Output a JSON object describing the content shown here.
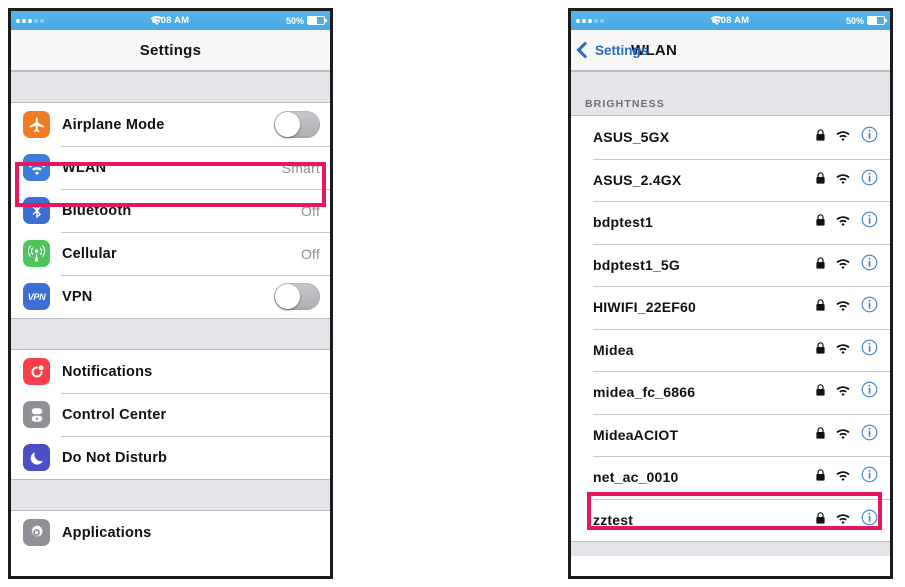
{
  "left_phone": {
    "status_bar": {
      "carrier": "",
      "time": "8:08 AM",
      "battery_percent": "50%",
      "wifi_icon": "wifi-icon",
      "battery_icon": "battery-icon",
      "signal_dots_filled": 3,
      "signal_dots_empty": 2
    },
    "nav": {
      "title": "Settings"
    },
    "groups": [
      {
        "rows": [
          {
            "label": "Airplane Mode",
            "icon": "airplane-icon",
            "icon_color": "#f07c25",
            "control": "toggle",
            "toggle_on": false
          },
          {
            "label": "WLAN",
            "icon": "wifi-icon",
            "icon_color": "#3b7ddd",
            "control": "value",
            "value": "Smart",
            "highlighted": true
          },
          {
            "label": "Bluetooth",
            "icon": "bluetooth-icon",
            "icon_color": "#3b6fd4",
            "control": "value",
            "value": "Off"
          },
          {
            "label": "Cellular",
            "icon": "cellular-icon",
            "icon_color": "#4cc65b",
            "control": "value",
            "value": "Off"
          },
          {
            "label": "VPN",
            "icon": "vpn-icon",
            "icon_color": "#3b6fd4",
            "control": "toggle",
            "toggle_on": false
          }
        ]
      },
      {
        "rows": [
          {
            "label": "Notifications",
            "icon": "notifications-icon",
            "icon_color": "#f8404a",
            "control": "none"
          },
          {
            "label": "Control Center",
            "icon": "control-center-icon",
            "icon_color": "#8e9096",
            "control": "none"
          },
          {
            "label": "Do Not Disturb",
            "icon": "moon-icon",
            "icon_color": "#4a4fc4",
            "control": "none"
          }
        ]
      },
      {
        "rows": [
          {
            "label": "Applications",
            "icon": "gear-icon",
            "icon_color": "#8e9096",
            "control": "none"
          }
        ]
      }
    ]
  },
  "right_phone": {
    "status_bar": {
      "time": "8:08 AM",
      "battery_percent": "50%",
      "wifi_icon": "wifi-icon",
      "battery_icon": "battery-icon",
      "signal_dots_filled": 3,
      "signal_dots_empty": 2
    },
    "nav": {
      "back_label": "Settings",
      "back_icon": "chevron-left-icon",
      "title": "WLAN"
    },
    "section_header": "BRIGHTNESS",
    "networks": [
      {
        "ssid": "ASUS_5GX",
        "secured": true,
        "signal": 3,
        "highlighted": false
      },
      {
        "ssid": "ASUS_2.4GX",
        "secured": true,
        "signal": 3,
        "highlighted": false
      },
      {
        "ssid": "bdptest1",
        "secured": true,
        "signal": 3,
        "highlighted": false
      },
      {
        "ssid": "bdptest1_5G",
        "secured": true,
        "signal": 3,
        "highlighted": false
      },
      {
        "ssid": "HIWIFI_22EF60",
        "secured": true,
        "signal": 3,
        "highlighted": false
      },
      {
        "ssid": "Midea",
        "secured": true,
        "signal": 3,
        "highlighted": false
      },
      {
        "ssid": "midea_fc_6866",
        "secured": true,
        "signal": 3,
        "highlighted": false
      },
      {
        "ssid": "MideaACIOT",
        "secured": true,
        "signal": 3,
        "highlighted": false
      },
      {
        "ssid": "net_ac_0010",
        "secured": true,
        "signal": 3,
        "highlighted": true
      },
      {
        "ssid": "zztest",
        "secured": true,
        "signal": 3,
        "highlighted": false
      }
    ],
    "row_icons": {
      "lock": "lock-icon",
      "wifi": "wifi-icon",
      "info": "info-icon"
    }
  },
  "colors": {
    "highlight": "#e8175d",
    "status_bar": "#50b0e8",
    "accent_blue": "#2b6cb8",
    "group_gap": "#e3e5e8"
  }
}
